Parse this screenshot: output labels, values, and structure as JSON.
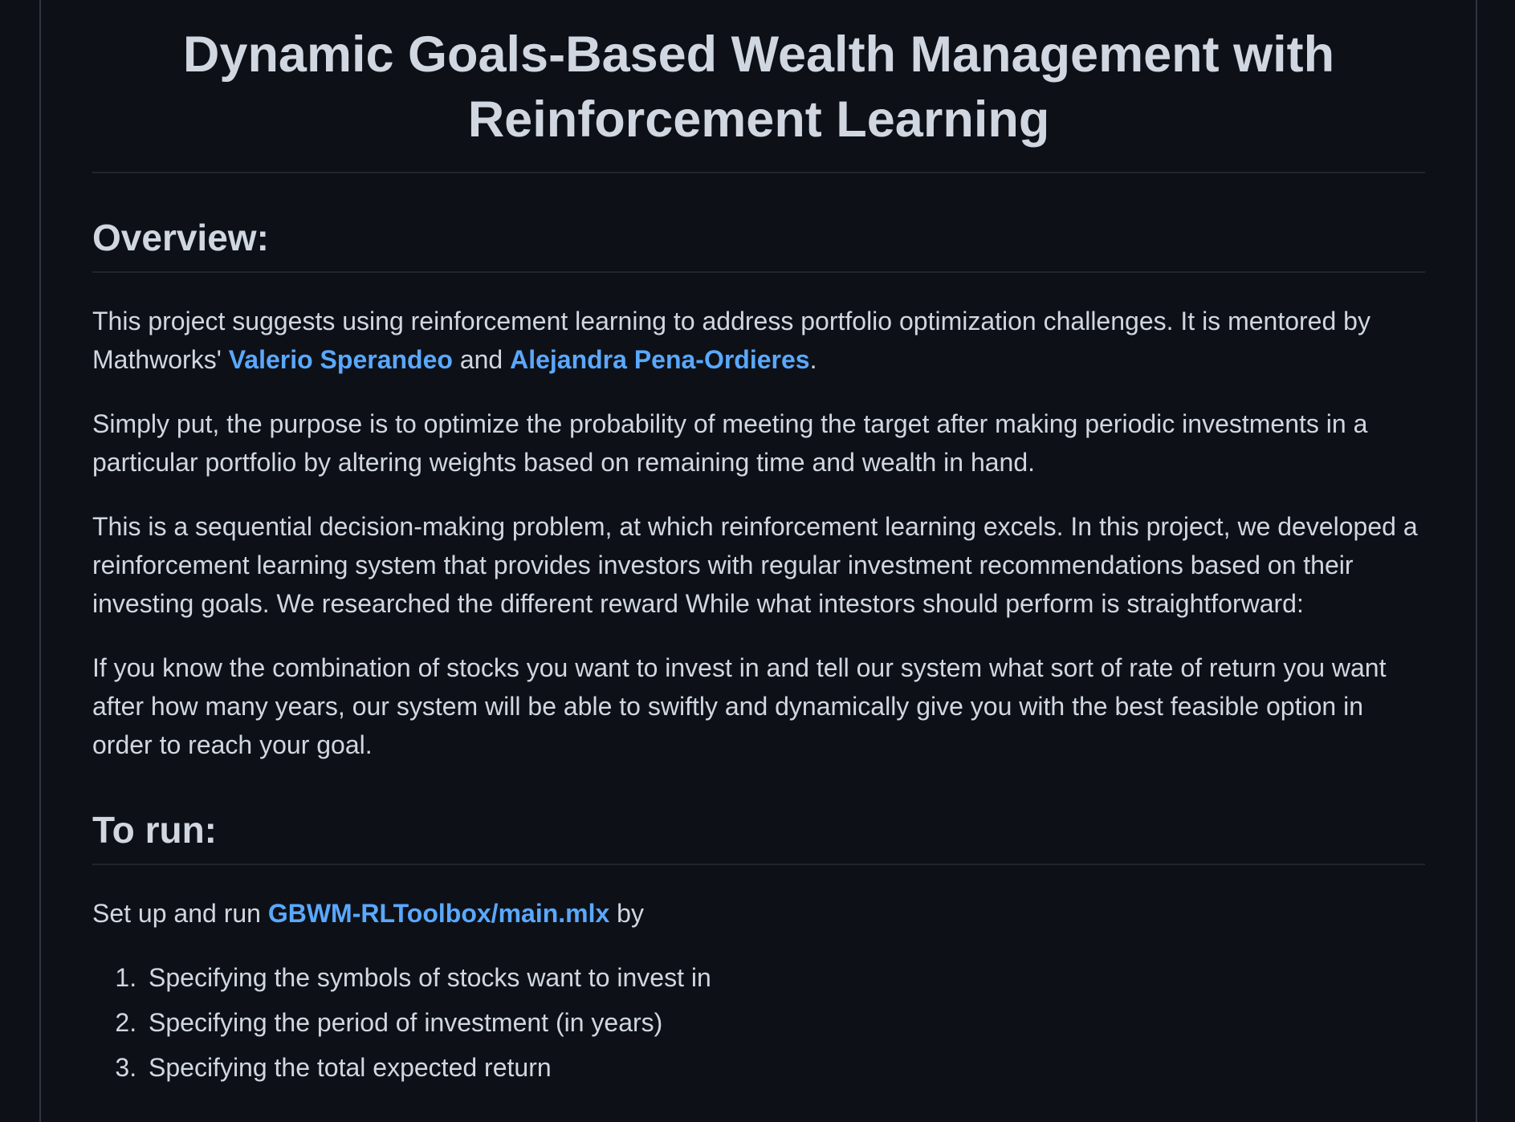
{
  "title": "Dynamic Goals-Based Wealth Management with Reinforcement Learning",
  "overview": {
    "heading": "Overview:",
    "p1": {
      "before": "This project suggests using reinforcement learning to address portfolio optimization challenges. It is mentored by Mathworks' ",
      "link1": "Valerio Sperandeo",
      "mid": " and ",
      "link2": "Alejandra Pena-Ordieres",
      "after": "."
    },
    "p2": "Simply put, the purpose is to optimize the probability of meeting the target after making periodic investments in a particular portfolio by altering weights based on remaining time and wealth in hand.",
    "p3": "This is a sequential decision-making problem, at which reinforcement learning excels. In this project, we developed a reinforcement learning system that provides investors with regular investment recommendations based on their investing goals. We researched the different reward While what intestors should perform is straightforward:",
    "p4": "If you know the combination of stocks you want to invest in and tell our system what sort of rate of return you want after how many years, our system will be able to swiftly and dynamically give you with the best feasible option in order to reach your goal."
  },
  "torun": {
    "heading": "To run:",
    "intro": {
      "before": "Set up and run ",
      "link": "GBWM-RLToolbox/main.mlx",
      "after": " by"
    },
    "steps": [
      "Specifying the symbols of stocks want to invest in",
      "Specifying the period of investment (in years)",
      "Specifying the total expected return"
    ]
  },
  "colors": {
    "background": "#0d1117",
    "text": "#d1d7e0",
    "link": "#5aa8ff",
    "divider": "#21262d"
  }
}
